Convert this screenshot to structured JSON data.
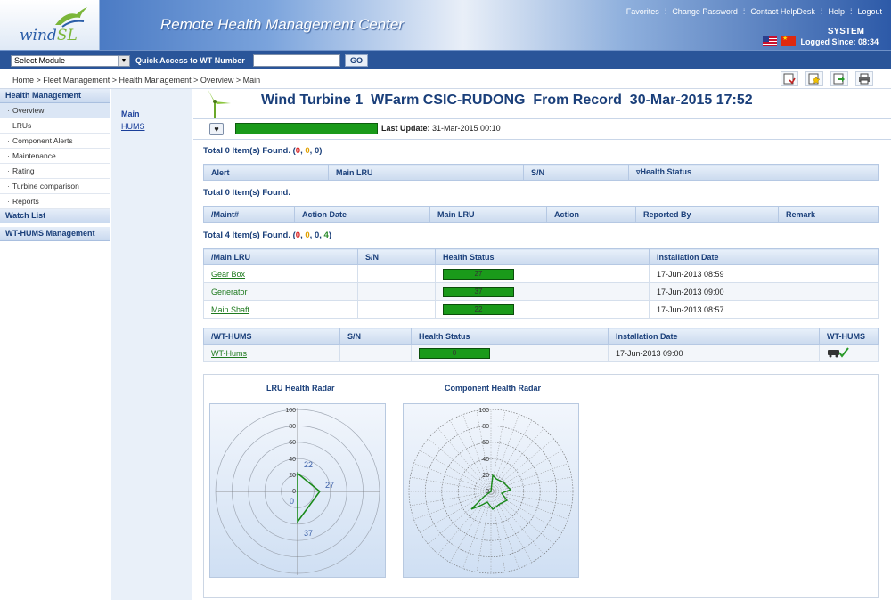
{
  "app": {
    "logo_text_left": "wind",
    "logo_text_right": "SL",
    "title": "Remote Health Management Center"
  },
  "top_links": [
    "Favorites",
    "Change Password",
    "Contact HelpDesk",
    "Help",
    "Logout"
  ],
  "user": {
    "name": "SYSTEM",
    "since": "Logged Since: 08:34"
  },
  "toolbar": {
    "module_select": "Select Module",
    "quick_access_label": "Quick Access to WT Number",
    "quick_access_value": "",
    "go_label": "GO"
  },
  "breadcrumb": "Home > Fleet Management > Health Management > Overview > Main",
  "tool_icons": [
    "report-icon",
    "favorite-star-icon",
    "export-icon",
    "print-icon"
  ],
  "leftnav": {
    "health_header": "Health Management",
    "health_items": [
      "Overview",
      "LRUs",
      "Component Alerts",
      "Maintenance",
      "Rating",
      "Turbine comparison",
      "Reports"
    ],
    "watch_header": "Watch List",
    "wthums_header": "WT-HUMS Management"
  },
  "subnav": {
    "main": "Main",
    "hums": "HUMS"
  },
  "header": {
    "title": "Wind Turbine 1  WFarm CSIC-RUDONG  From Record  30-Mar-2015 17:52",
    "last_update_label": "Last Update:",
    "last_update_value": "31-Mar-2015 00:10"
  },
  "alerts": {
    "total_prefix": "Total 0 Item(s) Found. (",
    "c1": "0",
    "c2": "0",
    "c3": "0",
    "total_suffix": ")",
    "columns": [
      "Alert",
      "Main LRU",
      "S/N",
      "Health Status"
    ]
  },
  "maint": {
    "total": "Total 0 Item(s) Found.",
    "columns": [
      "Maint#",
      "Action Date",
      "Main LRU",
      "Action",
      "Reported By",
      "Remark"
    ]
  },
  "lru": {
    "total_prefix": "Total 4 Item(s) Found. (",
    "c1": "0",
    "c2": "0",
    "c3": "0",
    "c4": "4",
    "total_suffix": ")",
    "columns": [
      "Main LRU",
      "S/N",
      "Health Status",
      "Installation Date"
    ],
    "rows": [
      {
        "name": "Gear Box",
        "sn": "",
        "health": "27",
        "date": "17-Jun-2013 08:59"
      },
      {
        "name": "Generator",
        "sn": "",
        "health": "37",
        "date": "17-Jun-2013 09:00"
      },
      {
        "name": "Main Shaft",
        "sn": "",
        "health": "22",
        "date": "17-Jun-2013 08:57"
      }
    ]
  },
  "hums": {
    "columns": [
      "WT-HUMS",
      "S/N",
      "Health Status",
      "Installation Date",
      "WT-HUMS"
    ],
    "rows": [
      {
        "name": "WT-Hums",
        "sn": "",
        "health": "0",
        "date": "17-Jun-2013 09:00"
      }
    ]
  },
  "radar": {
    "lru_title": "LRU Health Radar",
    "component_title": "Component Health Radar",
    "ticks": [
      "100",
      "80",
      "60",
      "40",
      "20",
      "0"
    ],
    "lru_values": [
      22,
      27,
      37,
      0
    ]
  },
  "colors": {
    "status_green": "#1a9a1a",
    "brand_blue": "#1a3f7a"
  }
}
